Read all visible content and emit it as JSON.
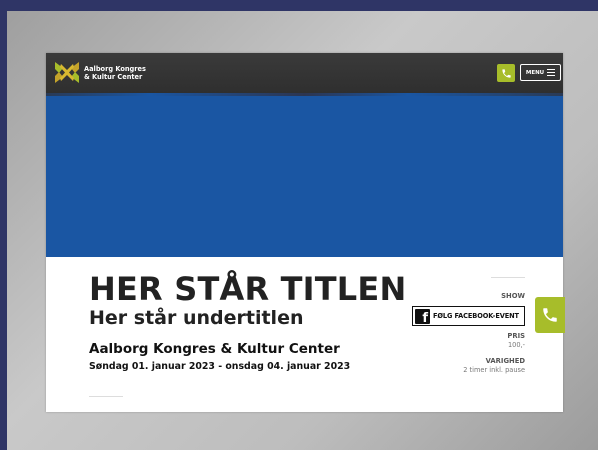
{
  "header": {
    "logo_line1": "Aalborg Kongres",
    "logo_line2": "& Kultur Center",
    "menu_label": "MENU"
  },
  "event": {
    "title": "HER STÅR TITLEN",
    "subtitle": "Her står undertitlen",
    "venue": "Aalborg Kongres & Kultur Center",
    "dates": "Søndag 01. januar 2023 - onsdag 04. januar 2023"
  },
  "sidebar": {
    "category": "SHOW",
    "facebook_button": "FØLG FACEBOOK-EVENT",
    "price_label": "PRIS",
    "price_value": "100,-",
    "duration_label": "VARIGHED",
    "duration_value": "2 timer inkl. pause"
  },
  "colors": {
    "accent": "#a7bd2a",
    "hero": "#1a56a3",
    "header": "#333333",
    "outer_frame": "#2f3566"
  },
  "icons": {
    "logo": "akkc-logo-icon",
    "phone": "phone-icon",
    "menu": "hamburger-icon",
    "facebook": "facebook-icon"
  }
}
